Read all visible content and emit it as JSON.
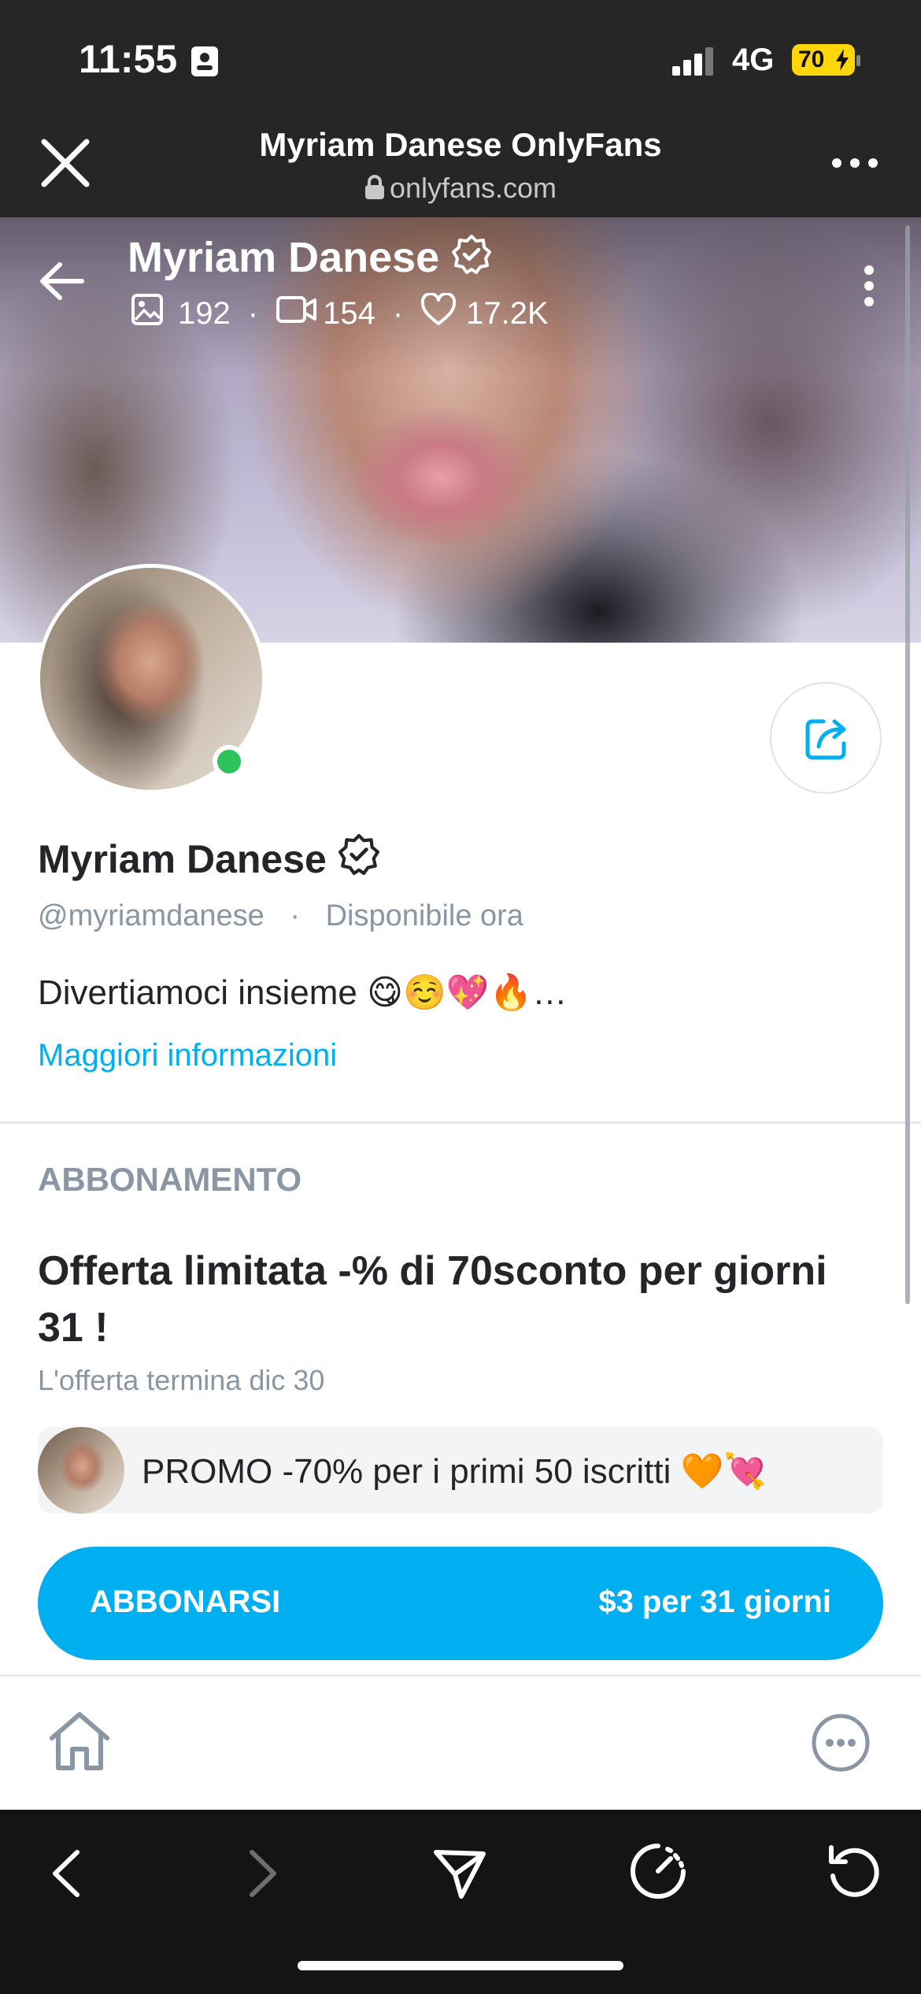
{
  "status_bar": {
    "time": "11:55",
    "network": "4G",
    "battery": "70"
  },
  "browser": {
    "title": "Myriam Danese OnlyFans",
    "url": "onlyfans.com"
  },
  "cover": {
    "name": "Myriam Danese",
    "photos_count": "192",
    "videos_count": "154",
    "likes_count": "17.2K"
  },
  "profile": {
    "name": "Myriam Danese",
    "handle": "@myriamdanese",
    "availability": "Disponibile ora",
    "bio": "Divertiamoci insieme 😋☺️💖🔥…",
    "more_info": "Maggiori informazioni"
  },
  "subscription": {
    "section_title": "ABBONAMENTO",
    "offer_title_line1": "Offerta limitata -% di 70sconto per giorni",
    "offer_title_line2": "31 !",
    "offer_end": "L'offerta termina dic 30",
    "promo_text": "PROMO -70% per i primi 50 iscritti 🧡💘",
    "button_label": "ABBONARSI",
    "button_price": "$3 per 31 giorni"
  },
  "icons": {
    "close": "close-icon",
    "more": "more-horizontal-icon",
    "back": "arrow-left-icon",
    "verified": "verified-badge-icon",
    "photos": "image-icon",
    "videos": "video-icon",
    "likes": "heart-icon",
    "share": "share-icon",
    "home": "home-icon",
    "nav_back": "chevron-left-icon",
    "nav_forward": "chevron-right-icon",
    "send": "send-icon",
    "speed": "speedometer-icon",
    "reload": "reload-icon"
  },
  "colors": {
    "accent": "#00aff0",
    "online": "#2dc25a",
    "battery": "#ffd60a"
  }
}
